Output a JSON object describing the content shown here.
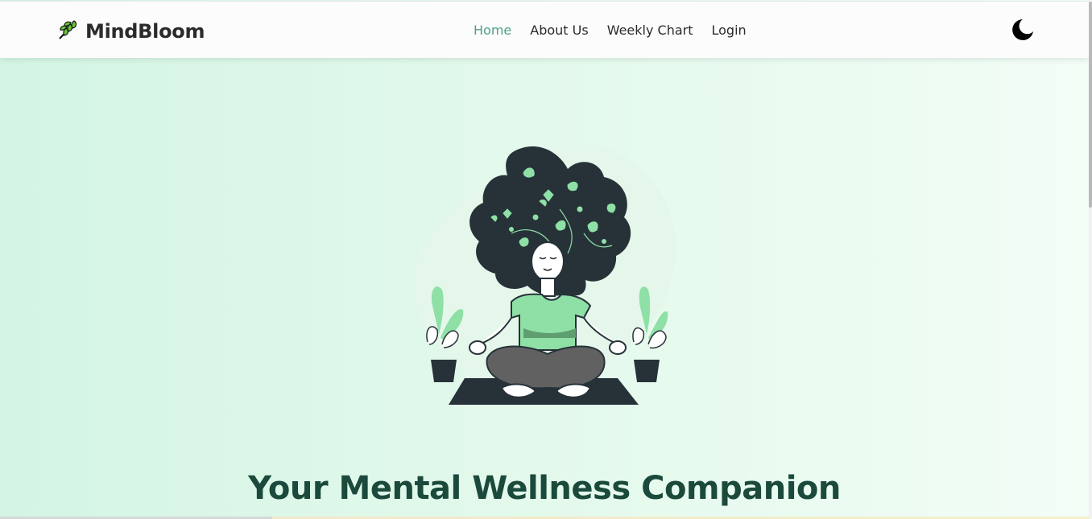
{
  "brand": {
    "name": "MindBloom",
    "logo_icon": "leaf-icon"
  },
  "nav": {
    "items": [
      {
        "label": "Home",
        "active": true
      },
      {
        "label": "About Us",
        "active": false
      },
      {
        "label": "Weekly Chart",
        "active": false
      },
      {
        "label": "Login",
        "active": false
      }
    ]
  },
  "theme_toggle": {
    "icon": "moon-icon"
  },
  "hero": {
    "illustration": "meditating-woman-illustration",
    "headline": "Your Mental Wellness Companion"
  },
  "colors": {
    "accent": "#4fa08a",
    "headline": "#1b4a3c",
    "leaf_green": "#8ee0a6",
    "dark": "#263238"
  }
}
